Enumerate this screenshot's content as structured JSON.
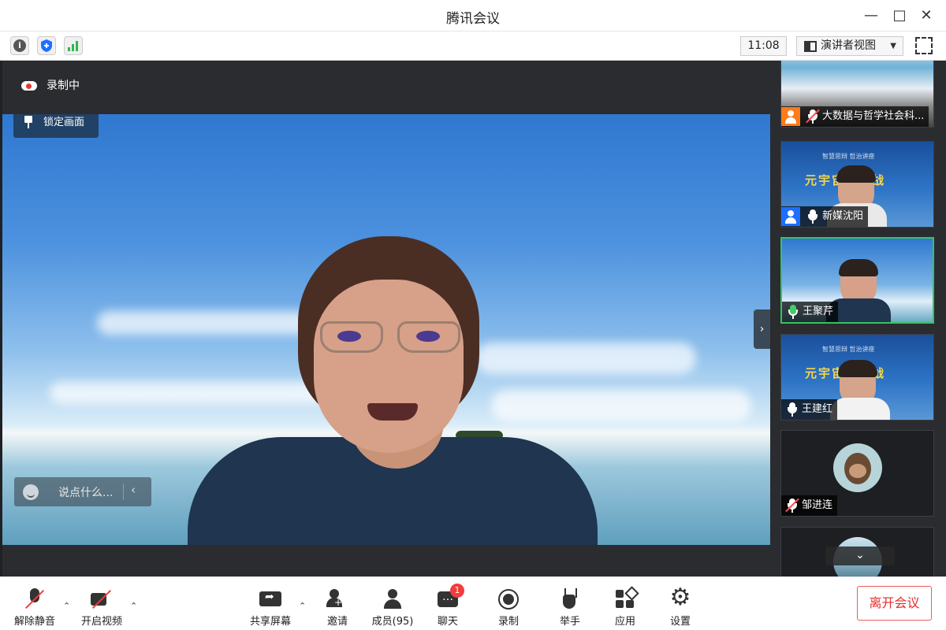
{
  "window": {
    "title": "腾讯会议"
  },
  "toolbar": {
    "time": "11:08",
    "view_mode": "演讲者视图"
  },
  "main": {
    "recording_status": "录制中",
    "pin_label": "锁定画面",
    "chat_placeholder": "说点什么..."
  },
  "participants": [
    {
      "name": "大数据与哲学社会科...",
      "mic": "muted",
      "avatar": "orange-user-icon"
    },
    {
      "name": "新媒沈阳",
      "mic": "on",
      "avatar": "blue-user-icon",
      "slide_title": "元宇宙与挑战",
      "slide_sub": "智慧思辩 哲治讲座"
    },
    {
      "name": "王聚芹",
      "mic": "speaking"
    },
    {
      "name": "王建红",
      "mic": "on",
      "slide_title": "元宇宙与挑战",
      "slide_sub": "智慧思辩 哲治讲座"
    },
    {
      "name": "邹进连",
      "mic": "muted"
    }
  ],
  "bottom": {
    "unmute": "解除静音",
    "start_video": "开启视频",
    "share_screen": "共享屏幕",
    "invite": "邀请",
    "members": "成员(95)",
    "chat": "聊天",
    "chat_badge": "1",
    "record": "录制",
    "raise_hand": "举手",
    "apps": "应用",
    "settings": "设置",
    "leave": "离开会议"
  },
  "colors": {
    "danger": "#f23c3c",
    "speaking": "#37c25f",
    "panel_bg": "#2a2c2f"
  }
}
